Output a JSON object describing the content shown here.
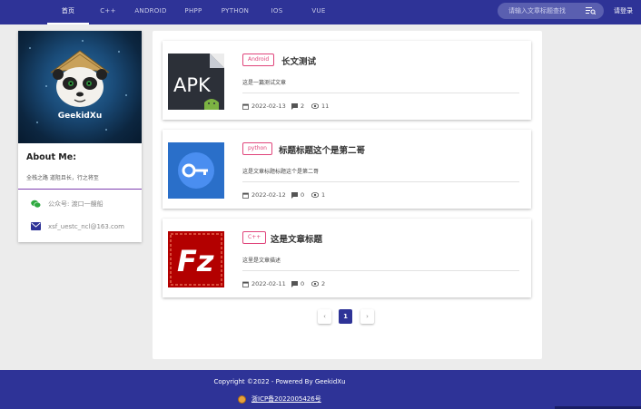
{
  "nav": {
    "items": [
      {
        "label": "首页",
        "active": true
      },
      {
        "label": "C++"
      },
      {
        "label": "ANDROID"
      },
      {
        "label": "PHPP"
      },
      {
        "label": "PYTHON"
      },
      {
        "label": "IOS"
      },
      {
        "label": "VUE"
      }
    ],
    "search_placeholder": "请输入文章标题查找",
    "login_label": "请登录"
  },
  "profile": {
    "name": "GeekidXu",
    "about_title": "About Me:",
    "about_text": "全栈之路 道阻且长，行之将至",
    "contacts": [
      {
        "icon": "wechat-icon",
        "text": "公众号: 渡口一艘船"
      },
      {
        "icon": "mail-icon",
        "text": "xsf_uestc_ncl@163.com"
      }
    ]
  },
  "articles": [
    {
      "tag": "Android",
      "title": "长文测试",
      "desc": "这是一篇测试文章",
      "date": "2022-02-13",
      "comments": "2",
      "views": "11",
      "thumb": "apk-thumb"
    },
    {
      "tag": "python",
      "title": "标题标题这个是第二哥",
      "desc": "这是文章标题标题这个是第二哥",
      "date": "2022-02-12",
      "comments": "0",
      "views": "1",
      "thumb": "key-thumb"
    },
    {
      "tag": "C++",
      "title": "这是文章标题",
      "desc": "这里是文章描述",
      "date": "2022-02-11",
      "comments": "0",
      "views": "2",
      "thumb": "filezilla-thumb"
    }
  ],
  "pagination": {
    "prev": "‹",
    "current": "1",
    "next": "›"
  },
  "footer": {
    "copyright": "Copyright ©2022 - Powered By GeekidXu",
    "icp": "浙ICP备2022005426号"
  },
  "colors": {
    "primary": "#2e3397",
    "tag": "#e0457b",
    "about_line": "#7d3fb0"
  }
}
